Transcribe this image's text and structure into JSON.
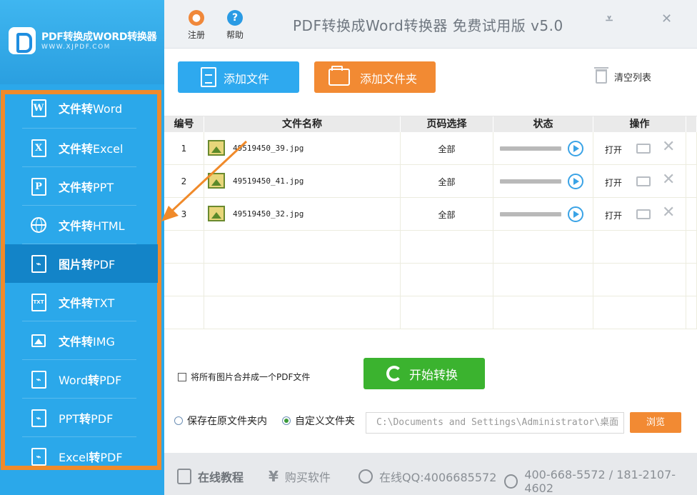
{
  "sidebar": {
    "logo_title": "PDF转换成WORD转换器",
    "logo_url": "WWW.XJPDF.COM",
    "items": [
      {
        "icon": "W",
        "cn": "文件转",
        "en": "Word"
      },
      {
        "icon": "X",
        "cn": "文件转",
        "en": "Excel"
      },
      {
        "icon": "P",
        "cn": "文件转",
        "en": "PPT"
      },
      {
        "icon": "globe",
        "cn": "文件转",
        "en": "HTML"
      },
      {
        "icon": "pdf",
        "cn": "图片转",
        "en": "PDF"
      },
      {
        "icon": "TXT",
        "cn": "文件转",
        "en": "TXT"
      },
      {
        "icon": "img",
        "cn": "文件转",
        "en": "IMG"
      },
      {
        "icon": "pdf",
        "pre": "Word",
        "cn": "转",
        "en": "PDF"
      },
      {
        "icon": "pdf",
        "pre": "PPT",
        "cn": "转",
        "en": "PDF"
      },
      {
        "icon": "pdf",
        "pre": "Excel",
        "cn": "转",
        "en": "PDF"
      }
    ]
  },
  "topbar": {
    "register_label": "注册",
    "help_label": "帮助",
    "title": "PDF转换成Word转换器 免费试用版 v5.0"
  },
  "toolbar": {
    "add_file": "添加文件",
    "add_folder": "添加文件夹",
    "clear_list": "清空列表"
  },
  "table": {
    "headers": [
      "编号",
      "文件名称",
      "页码选择",
      "状态",
      "操作"
    ],
    "rows": [
      {
        "num": "1",
        "file": "49519450_39.jpg",
        "pages": "全部",
        "action": "打开"
      },
      {
        "num": "2",
        "file": "49519450_41.jpg",
        "pages": "全部",
        "action": "打开"
      },
      {
        "num": "3",
        "file": "49519450_32.jpg",
        "pages": "全部",
        "action": "打开"
      }
    ]
  },
  "options": {
    "merge_label": "将所有图片合并成一个PDF文件",
    "start_button": "开始转换",
    "save_original": "保存在原文件夹内",
    "save_custom": "自定义文件夹",
    "path_value": "C:\\Documents and Settings\\Administrator\\桌面",
    "browse_button": "浏览"
  },
  "footer": {
    "tutorial": "在线教程",
    "buy": "购买软件",
    "qq": "在线QQ:4006685572",
    "phone": "400-668-5572 / 181-2107-4602"
  },
  "colors": {
    "sidebar_bg": "#2ba8ea",
    "sidebar_active": "#1384c8",
    "highlight_frame": "#f08a2a",
    "add_file_btn": "#2ea9ef",
    "add_folder_btn": "#f28a33",
    "start_btn": "#3bb32f"
  }
}
